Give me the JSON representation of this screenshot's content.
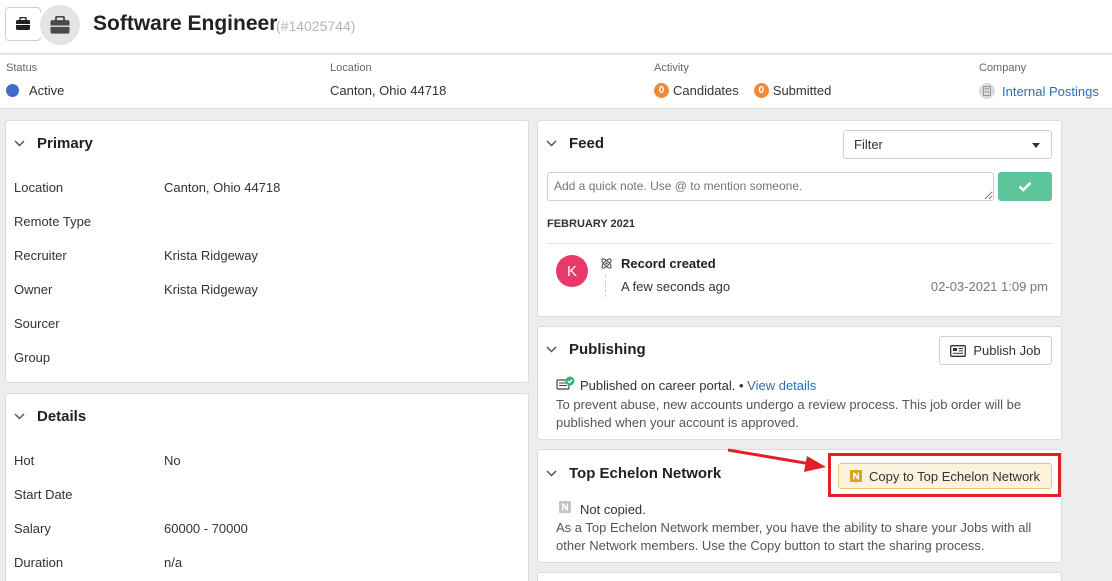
{
  "header": {
    "title": "Software Engineer",
    "id": "(#14025744)"
  },
  "summary": {
    "status_label": "Status",
    "status_value": "Active",
    "status_color": "#3f6cc5",
    "location_label": "Location",
    "location_value": "Canton, Ohio 44718",
    "activity_label": "Activity",
    "candidates_count": "0",
    "candidates_label": "Candidates",
    "submitted_count": "0",
    "submitted_label": "Submitted",
    "company_label": "Company",
    "company_value": "Internal Postings"
  },
  "primary": {
    "title": "Primary",
    "rows": [
      {
        "label": "Location",
        "value": "Canton, Ohio 44718"
      },
      {
        "label": "Remote Type",
        "value": ""
      },
      {
        "label": "Recruiter",
        "value": "Krista Ridgeway"
      },
      {
        "label": "Owner",
        "value": "Krista Ridgeway"
      },
      {
        "label": "Sourcer",
        "value": ""
      },
      {
        "label": "Group",
        "value": ""
      }
    ]
  },
  "details": {
    "title": "Details",
    "rows": [
      {
        "label": "Hot",
        "value": "No"
      },
      {
        "label": "Start Date",
        "value": ""
      },
      {
        "label": "Salary",
        "value": "60000 - 70000"
      },
      {
        "label": "Duration",
        "value": "n/a"
      }
    ]
  },
  "feed": {
    "title": "Feed",
    "filter_value": "Filter",
    "note_placeholder": "Add a quick note. Use @ to mention someone.",
    "month": "FEBRUARY 2021",
    "event": {
      "avatar": "K",
      "title": "Record created",
      "subtitle": "A few seconds ago",
      "timestamp": "02-03-2021 1:09 pm"
    }
  },
  "publishing": {
    "title": "Publishing",
    "button": "Publish Job",
    "status_text": "Published on career portal. •",
    "view_details": "View details",
    "line1": "To prevent abuse, new accounts undergo a review process. This job order will be",
    "line2": "published when your account is approved."
  },
  "network": {
    "title": "Top Echelon Network",
    "button": "Copy to Top Echelon Network",
    "status": "Not copied.",
    "line1": "As a Top Echelon Network member, you have the ability to share your Jobs with all",
    "line2": "other Network members. Use the Copy button to start the sharing process."
  },
  "colors": {
    "accent_green": "#5ec49a",
    "badge_orange": "#ee8a3c",
    "highlight_red": "#e02026",
    "link_blue": "#2f6db8"
  }
}
